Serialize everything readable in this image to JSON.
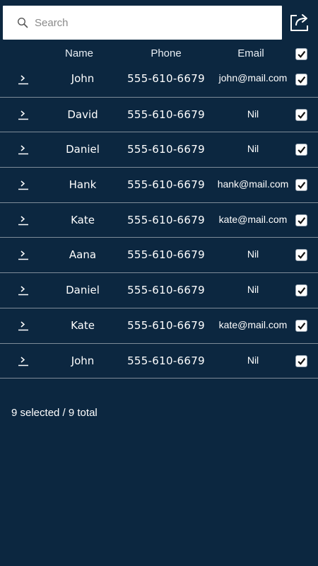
{
  "search": {
    "placeholder": "Search"
  },
  "header": {
    "name": "Name",
    "phone": "Phone",
    "email": "Email",
    "select_all_checked": true
  },
  "rows": [
    {
      "name": "John",
      "phone": "555-610-6679",
      "email": "john@mail.com",
      "checked": true
    },
    {
      "name": "David",
      "phone": "555-610-6679",
      "email": "Nil",
      "checked": true
    },
    {
      "name": "Daniel",
      "phone": "555-610-6679",
      "email": "Nil",
      "checked": true
    },
    {
      "name": "Hank",
      "phone": "555-610-6679",
      "email": "hank@mail.com",
      "checked": true
    },
    {
      "name": "Kate",
      "phone": "555-610-6679",
      "email": "kate@mail.com",
      "checked": true
    },
    {
      "name": "Aana",
      "phone": "555-610-6679",
      "email": "Nil",
      "checked": true
    },
    {
      "name": "Daniel",
      "phone": "555-610-6679",
      "email": "Nil",
      "checked": true
    },
    {
      "name": "Kate",
      "phone": "555-610-6679",
      "email": "kate@mail.com",
      "checked": true
    },
    {
      "name": "John",
      "phone": "555-610-6679",
      "email": "Nil",
      "checked": true
    }
  ],
  "footer": {
    "status": "9 selected / 9 total"
  },
  "icons": {
    "search": "search-icon",
    "share": "share-icon",
    "expand": "chevron-right-icon",
    "check": "checkmark-icon"
  },
  "colors": {
    "background": "#0c2740",
    "text": "#ffffff",
    "divider": "#7e8b98"
  }
}
